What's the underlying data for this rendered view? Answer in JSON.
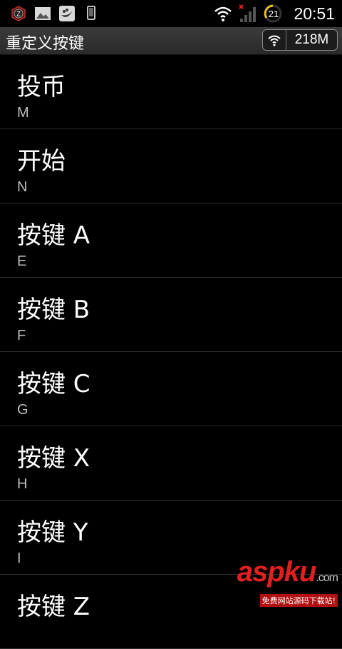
{
  "status_bar": {
    "time": "20:51",
    "battery": "21",
    "left_icons": [
      "app-z-icon",
      "image-icon",
      "app-pea-icon",
      "phone-icon"
    ],
    "right_icons": [
      "wifi-icon",
      "signal-icon",
      "battery-icon"
    ]
  },
  "title_bar": {
    "title": "重定义按键",
    "memory": "218M"
  },
  "list": {
    "items": [
      {
        "title": "投币",
        "key": "M"
      },
      {
        "title": "开始",
        "key": "N"
      },
      {
        "title": "按键 A",
        "key": "E"
      },
      {
        "title": "按键 B",
        "key": "F"
      },
      {
        "title": "按键 C",
        "key": "G"
      },
      {
        "title": "按键 X",
        "key": "H"
      },
      {
        "title": "按键 Y",
        "key": "I"
      },
      {
        "title": "按键 Z",
        "key": ""
      }
    ]
  },
  "watermark": {
    "brand": "aspku",
    "suffix": ".com",
    "tagline": "免费网站源码下载站!"
  }
}
